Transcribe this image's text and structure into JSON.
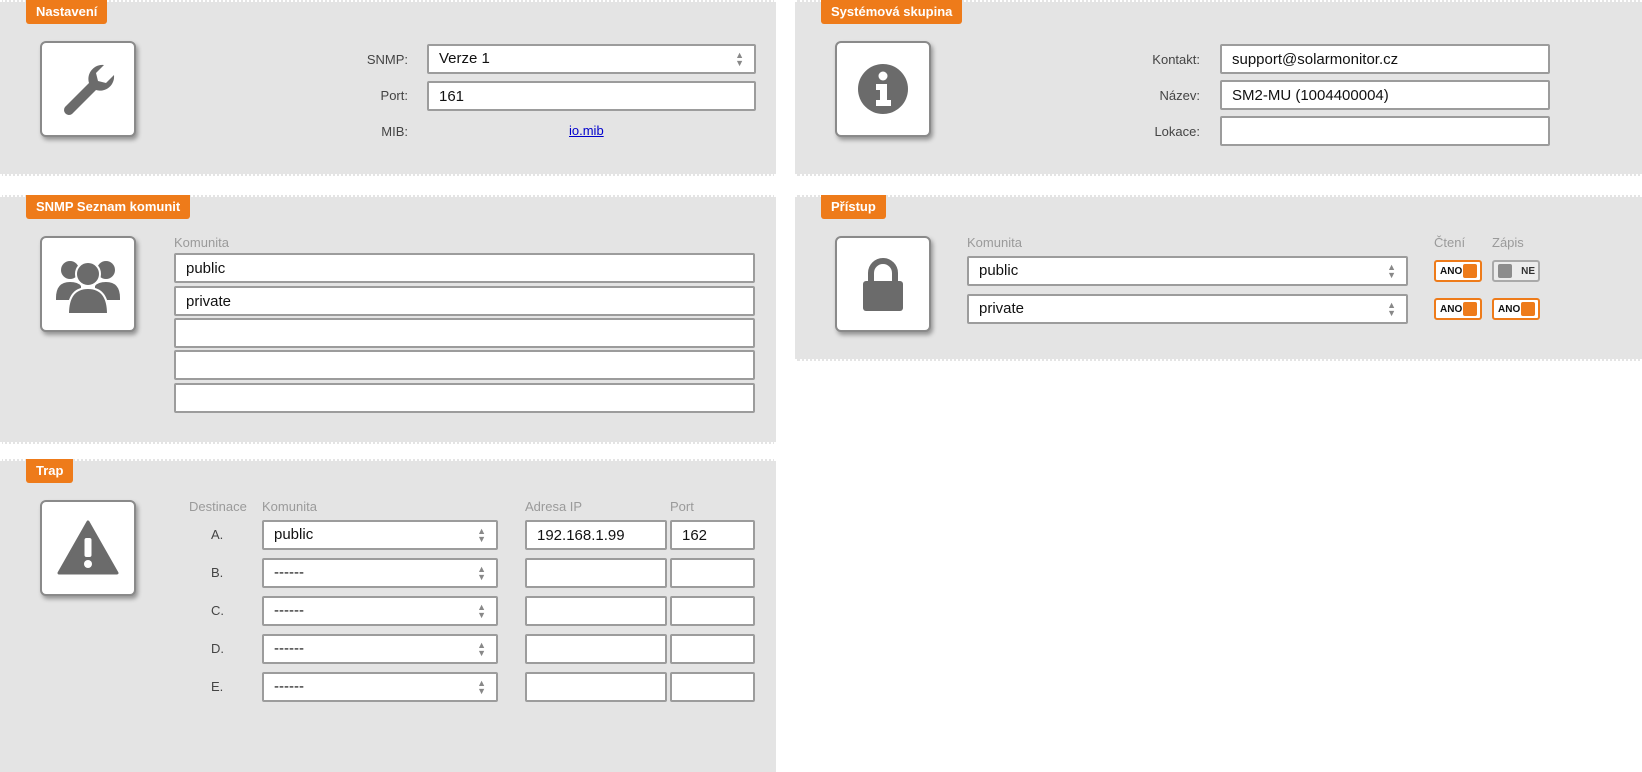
{
  "settings": {
    "title": "Nastavení",
    "snmp_label": "SNMP:",
    "snmp_value": "Verze 1",
    "port_label": "Port:",
    "port_value": "161",
    "mib_label": "MIB:",
    "mib_link": "io.mib"
  },
  "system_group": {
    "title": "Systémová skupina",
    "contact_label": "Kontakt:",
    "contact_value": "support@solarmonitor.cz",
    "name_label": "Název:",
    "name_value": "SM2-MU (1004400004)",
    "location_label": "Lokace:",
    "location_value": ""
  },
  "communities": {
    "title": "SNMP Seznam komunit",
    "column_header": "Komunita",
    "items": [
      "public",
      "private",
      "",
      "",
      ""
    ]
  },
  "access": {
    "title": "Přístup",
    "col_community": "Komunita",
    "col_read": "Čtení",
    "col_write": "Zápis",
    "rows": [
      {
        "community": "public",
        "read": "ANO",
        "write": "NE"
      },
      {
        "community": "private",
        "read": "ANO",
        "write": "ANO"
      }
    ]
  },
  "trap": {
    "title": "Trap",
    "col_destination": "Destinace",
    "col_community": "Komunita",
    "col_ip": "Adresa IP",
    "col_port": "Port",
    "rows": [
      {
        "dest": "A.",
        "community": "public",
        "ip": "192.168.1.99",
        "port": "162"
      },
      {
        "dest": "B.",
        "community": "------",
        "ip": "",
        "port": ""
      },
      {
        "dest": "C.",
        "community": "------",
        "ip": "",
        "port": ""
      },
      {
        "dest": "D.",
        "community": "------",
        "ip": "",
        "port": ""
      },
      {
        "dest": "E.",
        "community": "------",
        "ip": "",
        "port": ""
      }
    ]
  },
  "colors": {
    "accent": "#ee7b1a",
    "panel": "#e4e4e4",
    "icon": "#6b6b6b"
  },
  "icons": [
    "wrench-icon",
    "info-icon",
    "users-icon",
    "lock-icon",
    "warning-icon"
  ]
}
